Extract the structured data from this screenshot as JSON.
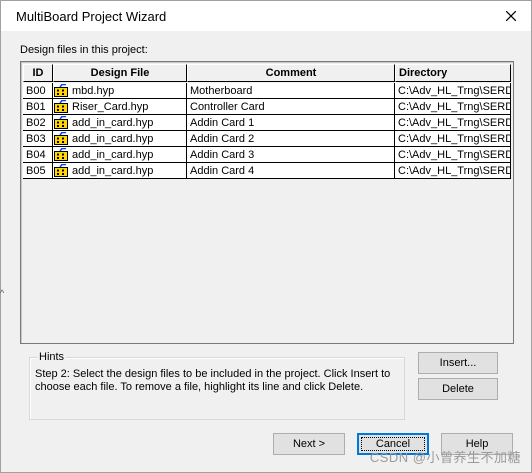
{
  "window": {
    "title": "MultiBoard Project Wizard"
  },
  "section_label": "Design files in this project:",
  "table": {
    "columns": [
      "ID",
      "Design File",
      "Comment",
      "Directory"
    ],
    "rows": [
      {
        "id": "B00",
        "file": "mbd.hyp",
        "comment": "Motherboard",
        "directory": "C:\\Adv_HL_Trng\\SERD"
      },
      {
        "id": "B01",
        "file": "Riser_Card.hyp",
        "comment": "Controller Card",
        "directory": "C:\\Adv_HL_Trng\\SERD"
      },
      {
        "id": "B02",
        "file": "add_in_card.hyp",
        "comment": "Addin Card 1",
        "directory": "C:\\Adv_HL_Trng\\SERD"
      },
      {
        "id": "B03",
        "file": "add_in_card.hyp",
        "comment": "Addin Card 2",
        "directory": "C:\\Adv_HL_Trng\\SERD"
      },
      {
        "id": "B04",
        "file": "add_in_card.hyp",
        "comment": "Addin Card 3",
        "directory": "C:\\Adv_HL_Trng\\SERD"
      },
      {
        "id": "B05",
        "file": "add_in_card.hyp",
        "comment": "Addin Card 4",
        "directory": "C:\\Adv_HL_Trng\\SERD"
      }
    ],
    "file_icon": "file-icon"
  },
  "hints": {
    "label": "Hints",
    "line1": "Step 2:  Select the design files to be included in the project. Click Insert to",
    "line2": "choose each file. To remove a file, highlight its line and click Delete."
  },
  "buttons": {
    "insert": "Insert...",
    "delete": "Delete",
    "next": "Next >",
    "cancel": "Cancel",
    "help": "Help"
  },
  "watermark": "CSDN @小曾养生不加糖",
  "left_marker": "^",
  "colors": {
    "focus": "#0078d7",
    "button": "#e1e1e1",
    "background": "#f0f0f0"
  }
}
